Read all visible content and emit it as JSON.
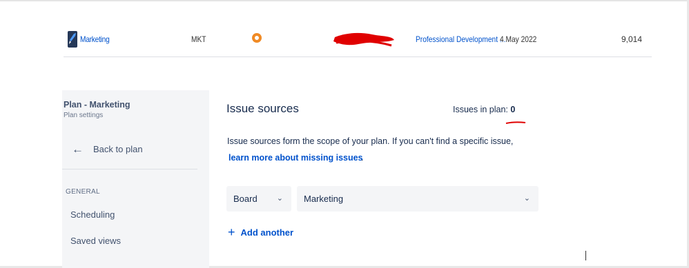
{
  "project_row": {
    "name": "Marketing",
    "key": "MKT",
    "type_icon": "orange-circle-icon",
    "lead": "",
    "category": "Professional Development ...",
    "date": "4 May 2022",
    "count": "9,014"
  },
  "sidebar": {
    "title": "Plan - Marketing",
    "subtitle": "Plan settings",
    "back_label": "Back to plan",
    "group_heading": "GENERAL",
    "items": [
      {
        "label": "Scheduling"
      },
      {
        "label": "Saved views"
      }
    ]
  },
  "main": {
    "title": "Issue sources",
    "issues_in_plan_label": "Issues in plan:",
    "issues_in_plan_value": "0",
    "description": "Issue sources form the scope of your plan. If you can't find a specific issue,",
    "learn_more": "learn more about missing issues",
    "learn_more_suffix": ".",
    "source_type": "Board",
    "source_value": "Marketing",
    "add_another": "Add another"
  },
  "colors": {
    "link": "#0052cc",
    "sidebar_bg": "#f4f5f7",
    "annotation_red": "#e00000",
    "type_icon": "#f08a24"
  }
}
